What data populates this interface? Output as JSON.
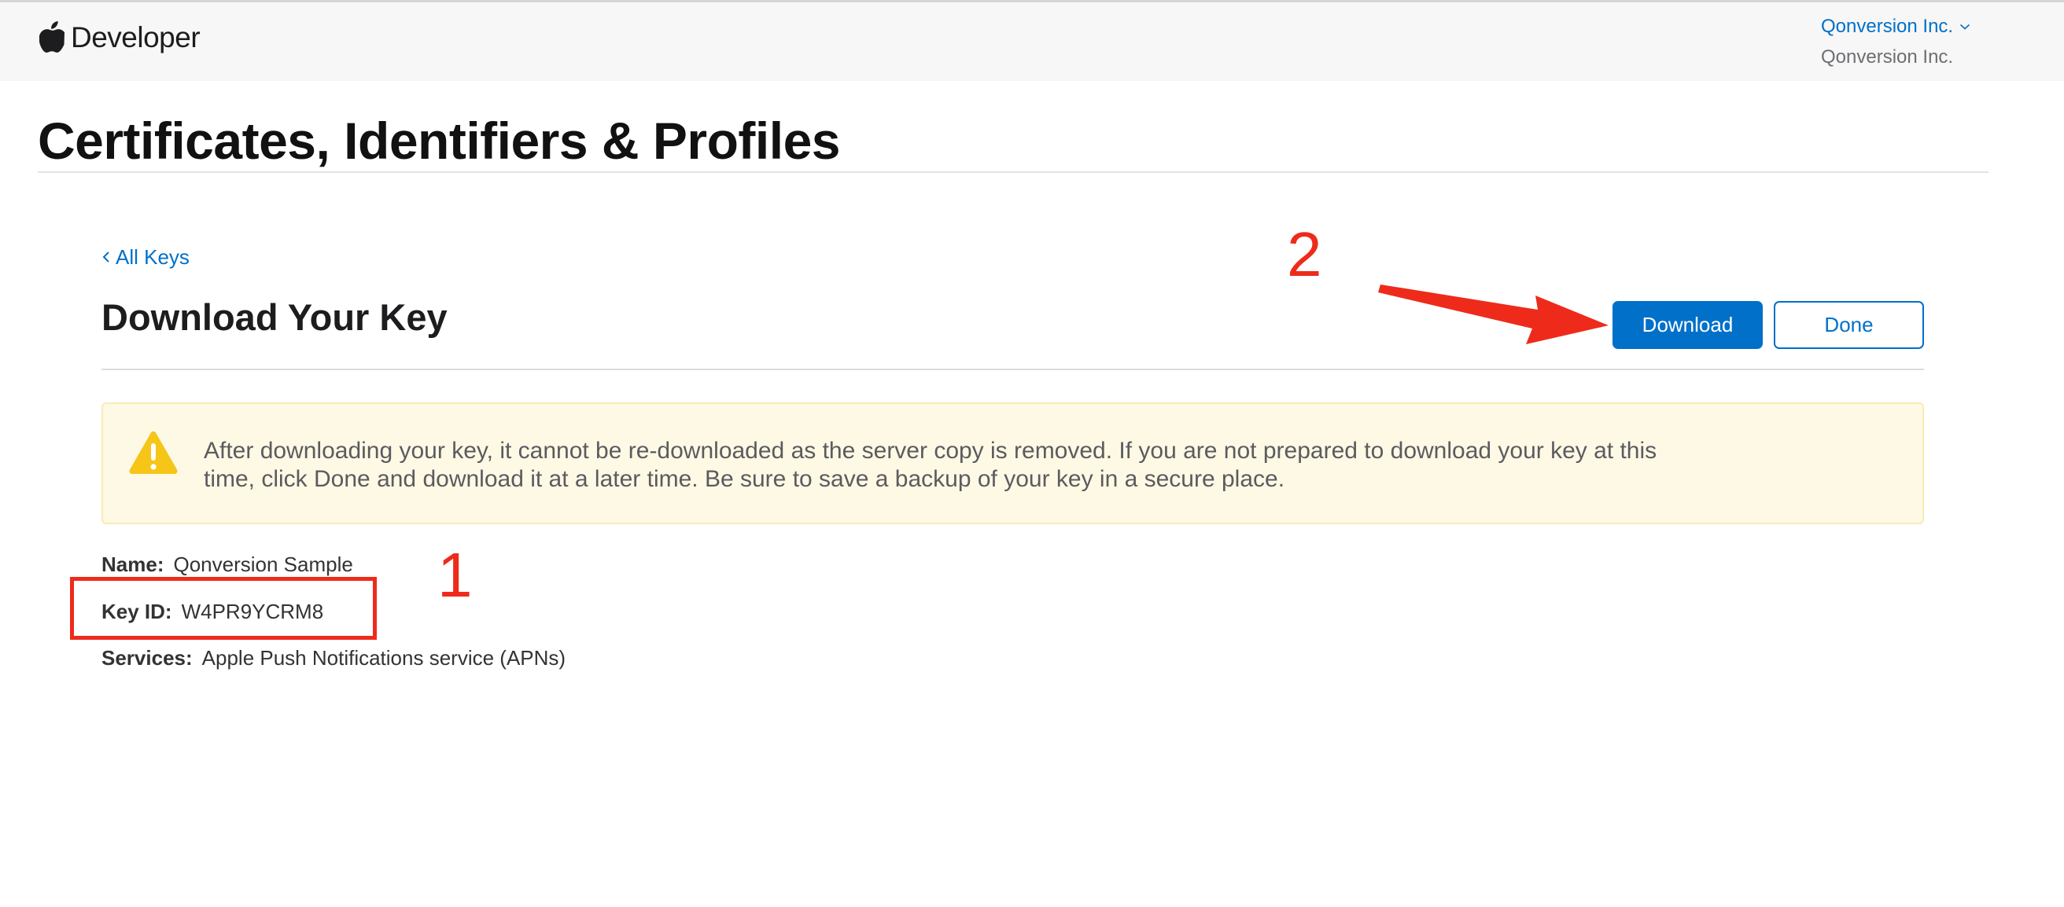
{
  "header": {
    "brand": "Developer",
    "account_link": "Qonversion Inc.",
    "account_sub": "Qonversion Inc."
  },
  "page": {
    "title": "Certificates, Identifiers & Profiles"
  },
  "nav": {
    "back_label": "All Keys"
  },
  "section": {
    "title": "Download Your Key",
    "download_label": "Download",
    "done_label": "Done"
  },
  "warning": {
    "text": "After downloading your key, it cannot be re-downloaded as the server copy is removed. If you are not prepared to download your key at this time, click Done and download it at a later time. Be sure to save a backup of your key in a secure place."
  },
  "details": {
    "name_label": "Name:",
    "name_value": "Qonversion Sample",
    "keyid_label": "Key ID:",
    "keyid_value": "W4PR9YCRM8",
    "services_label": "Services:",
    "services_value": "Apple Push Notifications service (APNs)"
  },
  "annotations": {
    "step1": "1",
    "step2": "2",
    "color": "#ee2b1b"
  },
  "colors": {
    "accent": "#0070c9",
    "warning_bg": "#fef9e5",
    "warning_icon": "#f5c518"
  },
  "icons": {
    "brand": "apple-logo-icon",
    "account_menu": "chevron-down-icon",
    "back": "chevron-left-icon",
    "warning": "warning-triangle-icon"
  }
}
